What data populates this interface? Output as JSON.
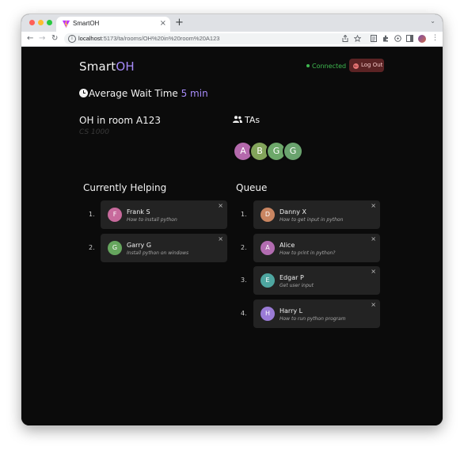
{
  "browser": {
    "tab_title": "SmartOH",
    "tab_close": "×",
    "new_tab": "+",
    "tab_menu": "⌄",
    "back": "←",
    "forward": "→",
    "reload": "↻",
    "url_host": "localhost",
    "url_path": ":5173/ta/rooms/OH%20in%20room%20A123",
    "toolbar_icons": [
      "share-icon",
      "bookmark-star-icon",
      "reader-icon",
      "extensions-icon",
      "media-icon",
      "sidepanel-icon",
      "profile-avatar",
      "menu-dots-icon"
    ]
  },
  "header": {
    "logo_main": "Smart",
    "logo_accent": "OH",
    "status": "Connected",
    "logout_label": "Log Out"
  },
  "wait": {
    "label": "Average Wait Time",
    "value": "5 min"
  },
  "room": {
    "title": "OH in room A123",
    "course": "CS 1000"
  },
  "tas": {
    "label": "TAs",
    "list": [
      {
        "initial": "A",
        "color": "#b469ac"
      },
      {
        "initial": "B",
        "color": "#83a55b"
      },
      {
        "initial": "G",
        "color": "#6da86a"
      },
      {
        "initial": "G",
        "color": "#6aa36e"
      }
    ]
  },
  "helping": {
    "title": "Currently Helping",
    "items": [
      {
        "num": "1.",
        "initial": "F",
        "name": "Frank S",
        "question": "How to install python",
        "color": "#c76a9c"
      },
      {
        "num": "2.",
        "initial": "G",
        "name": "Garry G",
        "question": "Install python on windows",
        "color": "#66a65e"
      }
    ]
  },
  "queue": {
    "title": "Queue",
    "items": [
      {
        "num": "1.",
        "initial": "D",
        "name": "Danny X",
        "question": "How to get input in python",
        "color": "#c98561"
      },
      {
        "num": "2.",
        "initial": "A",
        "name": "Alice",
        "question": "How to print in python?",
        "color": "#b26cb1"
      },
      {
        "num": "3.",
        "initial": "E",
        "name": "Edgar P",
        "question": "Get user input",
        "color": "#4ea6a0"
      },
      {
        "num": "4.",
        "initial": "H",
        "name": "Harry L",
        "question": "How to run python program",
        "color": "#9a7bd6"
      }
    ]
  },
  "close_glyph": "×",
  "colors": {
    "accent": "#a78bfa",
    "connected": "#3fb950",
    "logout_bg": "#5b2324",
    "card_bg": "#232323",
    "page_bg": "#0b0b0b"
  }
}
